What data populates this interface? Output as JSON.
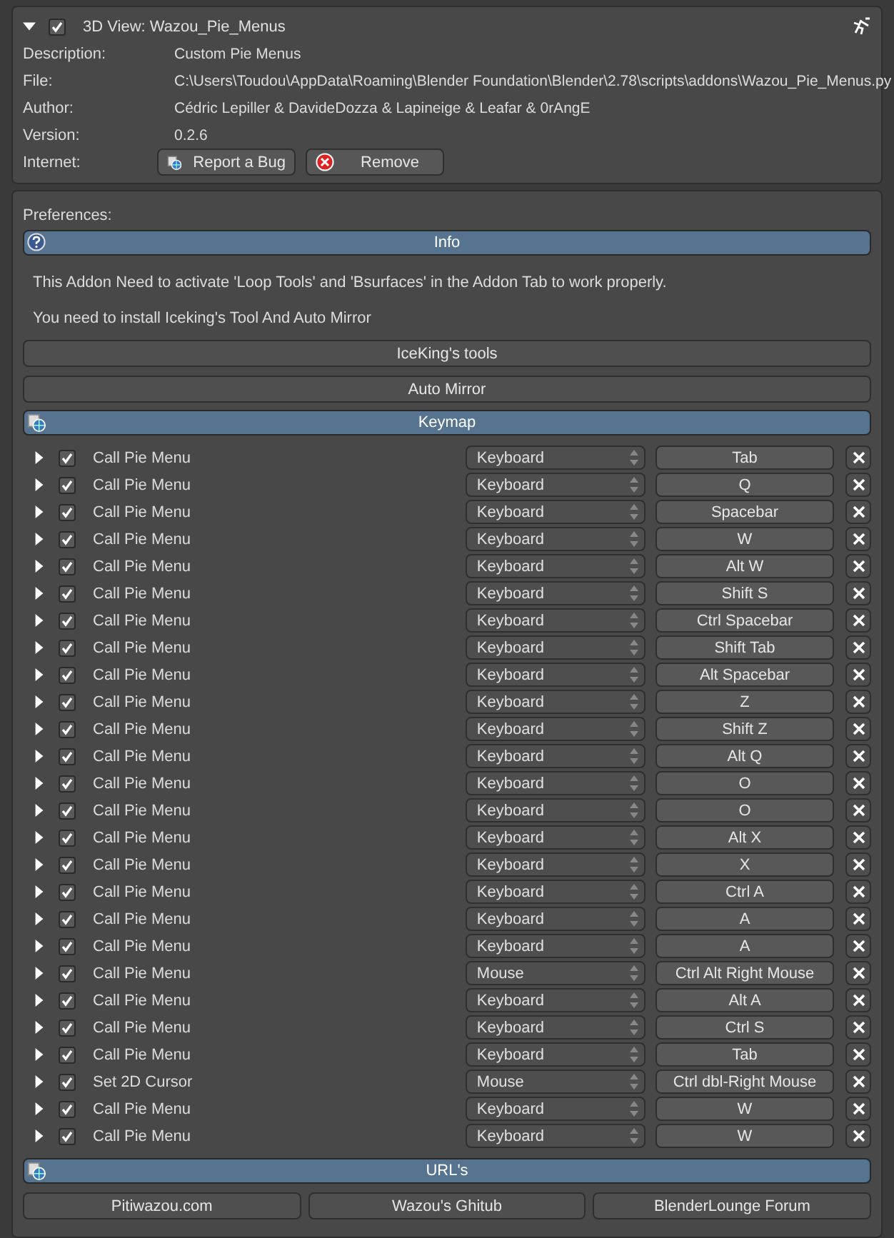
{
  "addon": {
    "expanded": true,
    "enabled": true,
    "title": "3D View: Wazou_Pie_Menus",
    "fields": [
      {
        "label": "Description:",
        "value": "Custom Pie Menus"
      },
      {
        "label": "File:",
        "value": "C:\\Users\\Toudou\\AppData\\Roaming\\Blender Foundation\\Blender\\2.78\\scripts\\addons\\Wazou_Pie_Menus.py"
      },
      {
        "label": "Author:",
        "value": "Cédric Lepiller & DavideDozza & Lapineige & Leafar & 0rAngE"
      },
      {
        "label": "Version:",
        "value": "0.2.6"
      }
    ],
    "internet_label": "Internet:",
    "internet_buttons": [
      {
        "label": "Report a Bug",
        "kind": "web"
      },
      {
        "label": "Remove",
        "kind": "remove"
      }
    ]
  },
  "preferences": {
    "label": "Preferences:",
    "info": {
      "title": "Info",
      "texts": [
        "This Addon Need to activate 'Loop Tools' and 'Bsurfaces' in the Addon Tab to work properly.",
        "You need to install Iceking's Tool And Auto Mirror"
      ],
      "buttons": [
        "IceKing's tools",
        "Auto Mirror"
      ]
    },
    "keymap": {
      "title": "Keymap",
      "rows": [
        {
          "expanded": false,
          "active": true,
          "name": "Call Pie Menu",
          "type": "Keyboard",
          "key": "Tab"
        },
        {
          "expanded": false,
          "active": true,
          "name": "Call Pie Menu",
          "type": "Keyboard",
          "key": "Q"
        },
        {
          "expanded": false,
          "active": true,
          "name": "Call Pie Menu",
          "type": "Keyboard",
          "key": "Spacebar"
        },
        {
          "expanded": false,
          "active": true,
          "name": "Call Pie Menu",
          "type": "Keyboard",
          "key": "W"
        },
        {
          "expanded": false,
          "active": true,
          "name": "Call Pie Menu",
          "type": "Keyboard",
          "key": "Alt W"
        },
        {
          "expanded": false,
          "active": true,
          "name": "Call Pie Menu",
          "type": "Keyboard",
          "key": "Shift S"
        },
        {
          "expanded": false,
          "active": true,
          "name": "Call Pie Menu",
          "type": "Keyboard",
          "key": "Ctrl Spacebar"
        },
        {
          "expanded": false,
          "active": true,
          "name": "Call Pie Menu",
          "type": "Keyboard",
          "key": "Shift Tab"
        },
        {
          "expanded": false,
          "active": true,
          "name": "Call Pie Menu",
          "type": "Keyboard",
          "key": "Alt Spacebar"
        },
        {
          "expanded": false,
          "active": true,
          "name": "Call Pie Menu",
          "type": "Keyboard",
          "key": "Z"
        },
        {
          "expanded": false,
          "active": true,
          "name": "Call Pie Menu",
          "type": "Keyboard",
          "key": "Shift Z"
        },
        {
          "expanded": false,
          "active": true,
          "name": "Call Pie Menu",
          "type": "Keyboard",
          "key": "Alt Q"
        },
        {
          "expanded": false,
          "active": true,
          "name": "Call Pie Menu",
          "type": "Keyboard",
          "key": "O"
        },
        {
          "expanded": false,
          "active": true,
          "name": "Call Pie Menu",
          "type": "Keyboard",
          "key": "O"
        },
        {
          "expanded": false,
          "active": true,
          "name": "Call Pie Menu",
          "type": "Keyboard",
          "key": "Alt X"
        },
        {
          "expanded": false,
          "active": true,
          "name": "Call Pie Menu",
          "type": "Keyboard",
          "key": "X"
        },
        {
          "expanded": false,
          "active": true,
          "name": "Call Pie Menu",
          "type": "Keyboard",
          "key": "Ctrl A"
        },
        {
          "expanded": false,
          "active": true,
          "name": "Call Pie Menu",
          "type": "Keyboard",
          "key": "A"
        },
        {
          "expanded": false,
          "active": true,
          "name": "Call Pie Menu",
          "type": "Keyboard",
          "key": "A"
        },
        {
          "expanded": false,
          "active": true,
          "name": "Call Pie Menu",
          "type": "Mouse",
          "key": "Ctrl Alt Right Mouse"
        },
        {
          "expanded": false,
          "active": true,
          "name": "Call Pie Menu",
          "type": "Keyboard",
          "key": "Alt A"
        },
        {
          "expanded": false,
          "active": true,
          "name": "Call Pie Menu",
          "type": "Keyboard",
          "key": "Ctrl S"
        },
        {
          "expanded": false,
          "active": true,
          "name": "Call Pie Menu",
          "type": "Keyboard",
          "key": "Tab"
        },
        {
          "expanded": false,
          "active": true,
          "name": "Set 2D Cursor",
          "type": "Mouse",
          "key": "Ctrl dbl-Right Mouse"
        },
        {
          "expanded": false,
          "active": true,
          "name": "Call Pie Menu",
          "type": "Keyboard",
          "key": "W"
        },
        {
          "expanded": false,
          "active": true,
          "name": "Call Pie Menu",
          "type": "Keyboard",
          "key": "W"
        }
      ]
    },
    "urls": {
      "title": "URL's",
      "buttons": [
        "Pitiwazou.com",
        "Wazou's Ghitub",
        "BlenderLounge Forum"
      ]
    }
  }
}
